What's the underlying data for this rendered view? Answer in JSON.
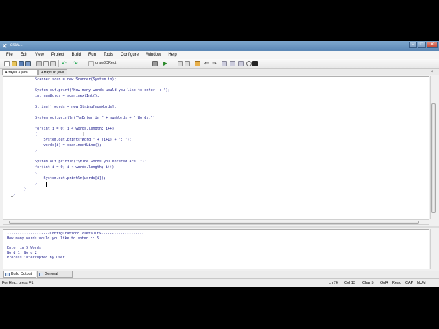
{
  "window": {
    "title": "draw..."
  },
  "menu": [
    "File",
    "Edit",
    "View",
    "Project",
    "Build",
    "Run",
    "Tools",
    "Configure",
    "Window",
    "Help"
  ],
  "toolbar": {
    "function_combo": "draw3DRect"
  },
  "tabs": [
    "Arrays13.java",
    "Arrays16.java"
  ],
  "code": [
    "Scanner scan = new Scanner(System.in);",
    "",
    "System.out.print(\"How many words would you like to enter :: \");",
    "int numWords = scan.nextInt();",
    "",
    "String[] words = new String[numWords];",
    "",
    "System.out.println(\"\\nEnter in \" + numWords + \" Words:\");",
    "",
    "for(int i = 0; i < words.length; i++)",
    "{",
    "    System.out.print(\"Word \" + (i+1) + \": \");",
    "    words[i] = scan.nextLine();",
    "}",
    "",
    "System.out.println(\"\\nThe words you entered are: \");",
    "for(int i = 0; i < words.length; i++)",
    "{",
    "    System.out.println(words[i]);",
    "}",
    "}",
    "}"
  ],
  "output": [
    "--------------------Configuration: <Default>--------------------",
    "How many words would you like to enter :: 5",
    "",
    "Enter in 5 Words",
    "Word 1: Word 2:",
    "Process interrupted by user"
  ],
  "output_tabs": [
    "Build Output",
    "General Output"
  ],
  "status": {
    "help": "For Help, press F1",
    "line": "Ln 76",
    "col": "Col 13",
    "char": "Char 5",
    "modes": [
      "OVR",
      "Read",
      "CAP",
      "NUM"
    ]
  }
}
